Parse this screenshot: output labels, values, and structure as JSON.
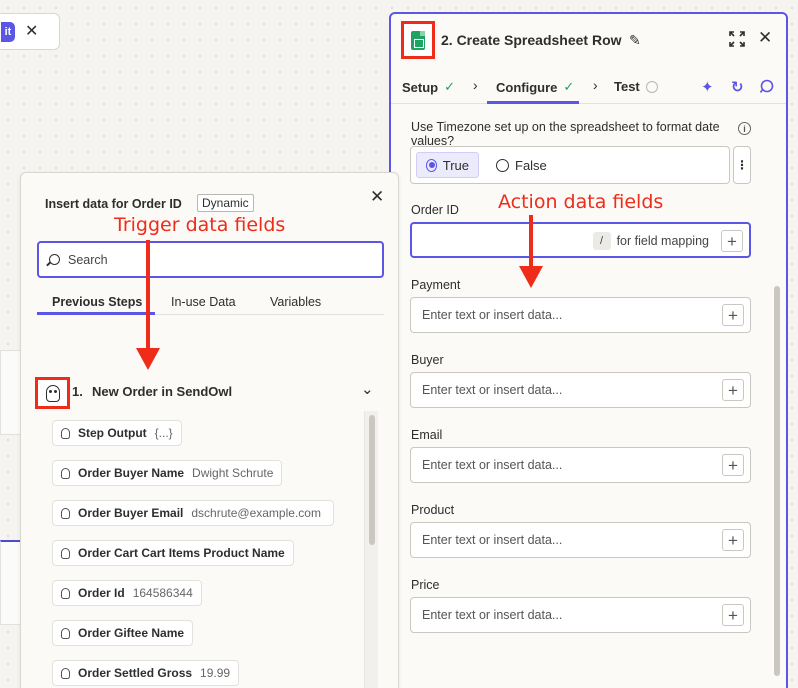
{
  "mini_toolbar": {
    "pill_text": "it",
    "close_glyph": "✕"
  },
  "right_panel": {
    "title": "2. Create Spreadsheet Row",
    "tabs": [
      {
        "label": "Setup",
        "status": "complete"
      },
      {
        "label": "Configure",
        "status": "complete"
      },
      {
        "label": "Test",
        "status": "pending"
      }
    ],
    "timezone_question": "Use Timezone set up on the spreadsheet to format date values?",
    "radio_options": [
      "True",
      "False"
    ],
    "radio_selected": "True",
    "fields": [
      {
        "label": "Order ID",
        "placeholder": "",
        "hint_key": "/",
        "hint_text": "for field mapping"
      },
      {
        "label": "Payment",
        "placeholder": "Enter text or insert data..."
      },
      {
        "label": "Buyer",
        "placeholder": "Enter text or insert data..."
      },
      {
        "label": "Email",
        "placeholder": "Enter text or insert data..."
      },
      {
        "label": "Product",
        "placeholder": "Enter text or insert data..."
      },
      {
        "label": "Price",
        "placeholder": "Enter text or insert data..."
      }
    ]
  },
  "insert_panel": {
    "title": "Insert data for Order ID",
    "badge": "Dynamic",
    "search_placeholder": "Search",
    "tabs": [
      "Previous Steps",
      "In-use Data",
      "Variables"
    ],
    "active_tab": "Previous Steps",
    "step": {
      "number": "1.",
      "name": "New Order in SendOwl"
    },
    "items": [
      {
        "label": "Step Output",
        "value": "{...}"
      },
      {
        "label": "Order Buyer Name",
        "value": "Dwight Schrute"
      },
      {
        "label": "Order Buyer Email",
        "value": "dschrute@example.com"
      },
      {
        "label": "Order Cart Cart Items Product Name",
        "value": ""
      },
      {
        "label": "Order Id",
        "value": "164586344"
      },
      {
        "label": "Order Giftee Name",
        "value": ""
      },
      {
        "label": "Order Settled Gross",
        "value": "19.99"
      }
    ]
  },
  "annotations": {
    "trigger": "Trigger data fields",
    "action": "Action data fields",
    "color": "#ef2c1a"
  },
  "colors": {
    "accent": "#5b57e6",
    "annotation": "#ef2c1a",
    "sheets_green": "#1ea362"
  }
}
